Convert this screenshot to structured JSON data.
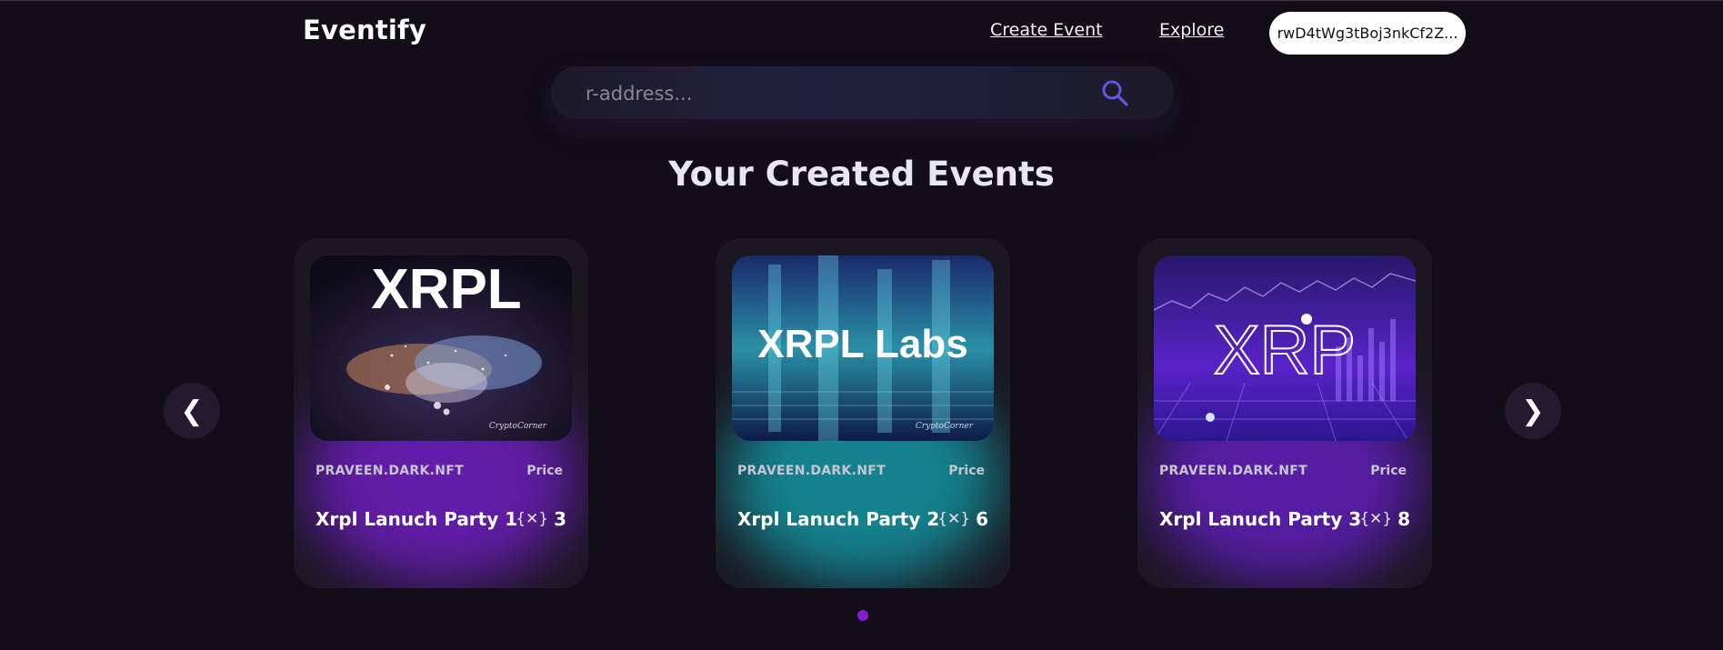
{
  "header": {
    "logo": "Eventify",
    "nav": {
      "create_event": "Create Event",
      "explore": "Explore"
    },
    "wallet_address": "rwD4tWg3tBoj3nkCf2Z..."
  },
  "search": {
    "placeholder": "r-address...",
    "value": "",
    "icon": "search-icon"
  },
  "section_title": "Your Created Events",
  "carousel": {
    "prev_label": "❮",
    "next_label": "❯",
    "active_dot": 0,
    "cards": [
      {
        "image_text": "XRPL",
        "creator": "PRAVEEN.DARK.NFT",
        "price_label": "Price",
        "name": "Xrpl Lanuch Party 1",
        "currency_icon": "{✕}",
        "price": "3",
        "glow_color": "#7a1fd6"
      },
      {
        "image_text": "XRPL Labs",
        "creator": "PRAVEEN.DARK.NFT",
        "price_label": "Price",
        "name": "Xrpl Lanuch Party 2",
        "currency_icon": "{✕}",
        "price": "6",
        "glow_color": "#12a7b4"
      },
      {
        "image_text": "XRP",
        "creator": "PRAVEEN.DARK.NFT",
        "price_label": "Price",
        "name": "Xrpl Lanuch Party 3",
        "currency_icon": "{✕}",
        "price": "8",
        "glow_color": "#6a1fd0"
      }
    ]
  },
  "colors": {
    "background": "#110e18",
    "accent": "#8b1ad6",
    "search_icon": "#5c5bd9"
  }
}
